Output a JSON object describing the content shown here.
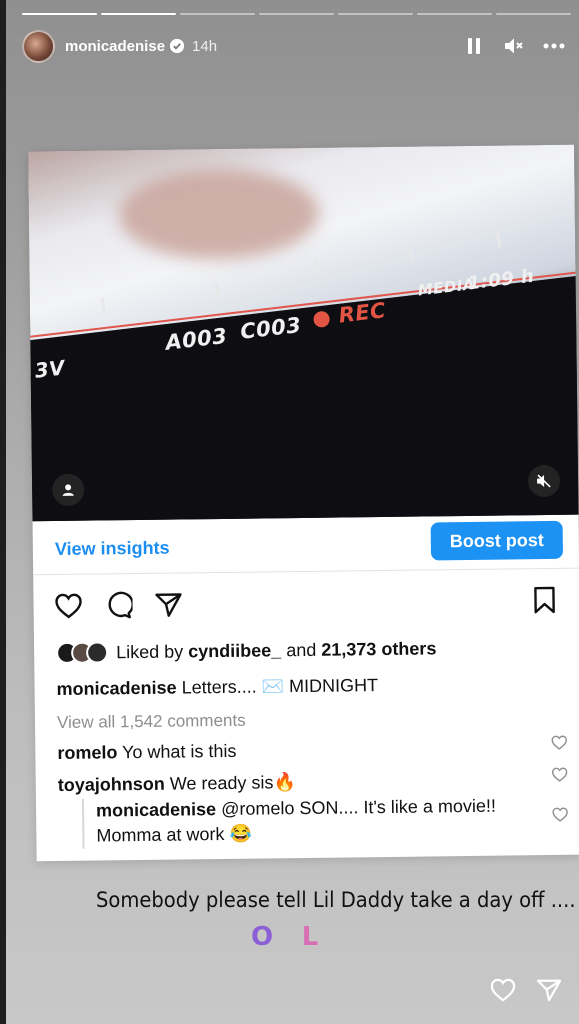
{
  "story": {
    "segments": 7,
    "segments_completed": 2,
    "username": "monicadenise",
    "time_ago": "14h",
    "caption": "Somebody please tell Lil Daddy take a day off ....",
    "sticker_1": "O",
    "sticker_2": "L"
  },
  "post": {
    "video_overlay": {
      "left_label": "3V",
      "reel_id": "A003",
      "clip_id": "C003",
      "rec_label": "REC",
      "media_label": "MEDIA",
      "media_time": "1:09 h"
    },
    "view_insights_label": "View insights",
    "boost_post_label": "Boost post",
    "liked_by_prefix": "Liked by",
    "liked_by_user": "cyndiibee_",
    "liked_by_and": "and",
    "liked_by_count": "21,373 others",
    "caption_user": "monicadenise",
    "caption_text": "Letters.... ✉️ MIDNIGHT",
    "view_comments": "View all 1,542 comments",
    "comments": [
      {
        "user": "romelo",
        "text": "Yo what is this"
      },
      {
        "user": "toyajohnson",
        "text": "We ready sis🔥"
      }
    ],
    "reply": {
      "user": "monicadenise",
      "text_line1": "@romelo SON.... It's like a movie!!",
      "text_line2": "Momma at work 😂"
    }
  },
  "colors": {
    "accent_blue": "#1d92f5",
    "rec_red": "#e25544"
  }
}
